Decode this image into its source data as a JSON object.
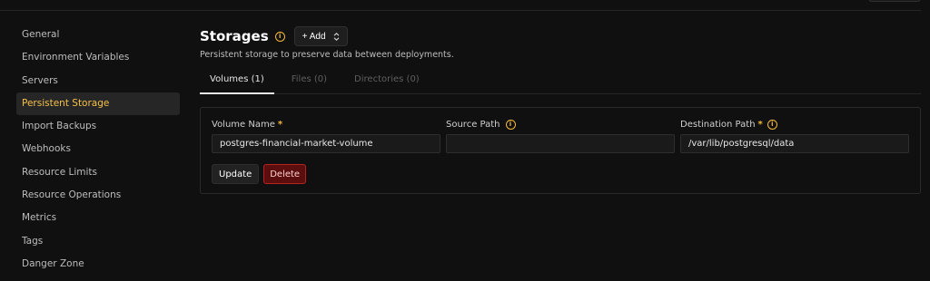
{
  "sidebar": {
    "items": [
      {
        "label": "General"
      },
      {
        "label": "Environment Variables"
      },
      {
        "label": "Servers"
      },
      {
        "label": "Persistent Storage",
        "active": true
      },
      {
        "label": "Import Backups"
      },
      {
        "label": "Webhooks"
      },
      {
        "label": "Resource Limits"
      },
      {
        "label": "Resource Operations"
      },
      {
        "label": "Metrics"
      },
      {
        "label": "Tags"
      },
      {
        "label": "Danger Zone"
      }
    ]
  },
  "header": {
    "title": "Storages",
    "info_icon": "i",
    "add_label": "+ Add",
    "subtitle": "Persistent storage to preserve data between deployments."
  },
  "tabs": [
    {
      "label": "Volumes (1)",
      "active": true
    },
    {
      "label": "Files (0)"
    },
    {
      "label": "Directories (0)"
    }
  ],
  "volume": {
    "volume_name_label": "Volume Name",
    "volume_name_value": "postgres-financial-market-volume",
    "source_path_label": "Source Path",
    "source_path_value": "",
    "destination_path_label": "Destination Path",
    "destination_path_value": "/var/lib/postgresql/data",
    "required_mark": "*",
    "update_label": "Update",
    "delete_label": "Delete"
  },
  "colors": {
    "accent": "#f5c14a",
    "background": "#101010",
    "danger": "#b52222"
  }
}
